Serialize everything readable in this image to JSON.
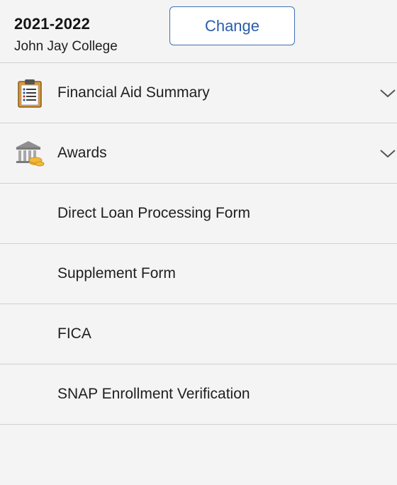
{
  "header": {
    "term": "2021-2022",
    "institution": "John Jay College",
    "change_label": "Change"
  },
  "nav": {
    "items": [
      {
        "label": "Financial Aid Summary",
        "icon": "clipboard-list-icon",
        "expandable": true
      },
      {
        "label": "Awards",
        "icon": "bank-coins-icon",
        "expandable": true
      },
      {
        "label": "Direct Loan Processing Form",
        "expandable": false
      },
      {
        "label": "Supplement Form",
        "expandable": false
      },
      {
        "label": "FICA",
        "expandable": false
      },
      {
        "label": "SNAP Enrollment Verification",
        "expandable": false
      }
    ]
  },
  "colors": {
    "accent": "#2a5ca8",
    "background": "#f4f4f4",
    "divider": "#d0d0d0"
  }
}
